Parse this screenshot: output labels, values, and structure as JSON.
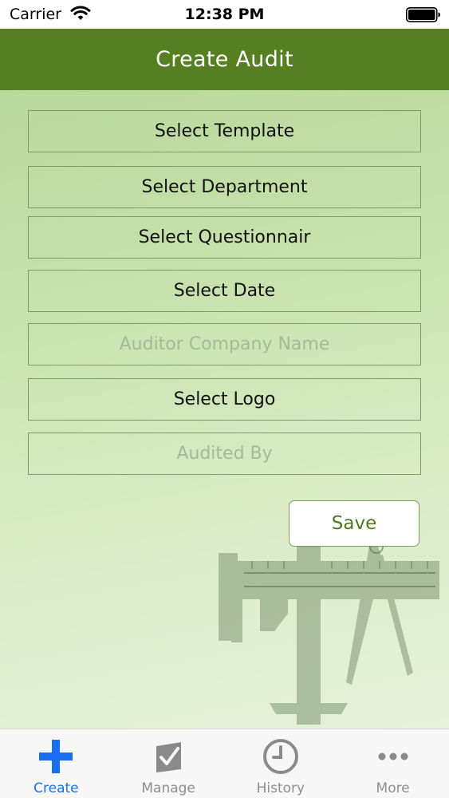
{
  "status_bar": {
    "carrier": "Carrier",
    "time": "12:38 PM"
  },
  "nav": {
    "title": "Create Audit"
  },
  "form": {
    "select_template": "Select Template",
    "select_department": "Select Department",
    "select_questionnaire": "Select Questionnair",
    "select_date": "Select Date",
    "auditor_company_placeholder": "Auditor Company Name",
    "select_logo": "Select Logo",
    "audited_by_placeholder": "Audited By",
    "save_label": "Save"
  },
  "tabs": [
    {
      "label": "Create",
      "icon": "plus-icon",
      "active": true
    },
    {
      "label": "Manage",
      "icon": "checkbox-icon",
      "active": false
    },
    {
      "label": "History",
      "icon": "clock-icon",
      "active": false
    },
    {
      "label": "More",
      "icon": "more-dots-icon",
      "active": false
    }
  ],
  "colors": {
    "nav_bar": "#567f22",
    "accent_active_tab": "#1a6ff0",
    "save_text": "#4f7a20"
  }
}
